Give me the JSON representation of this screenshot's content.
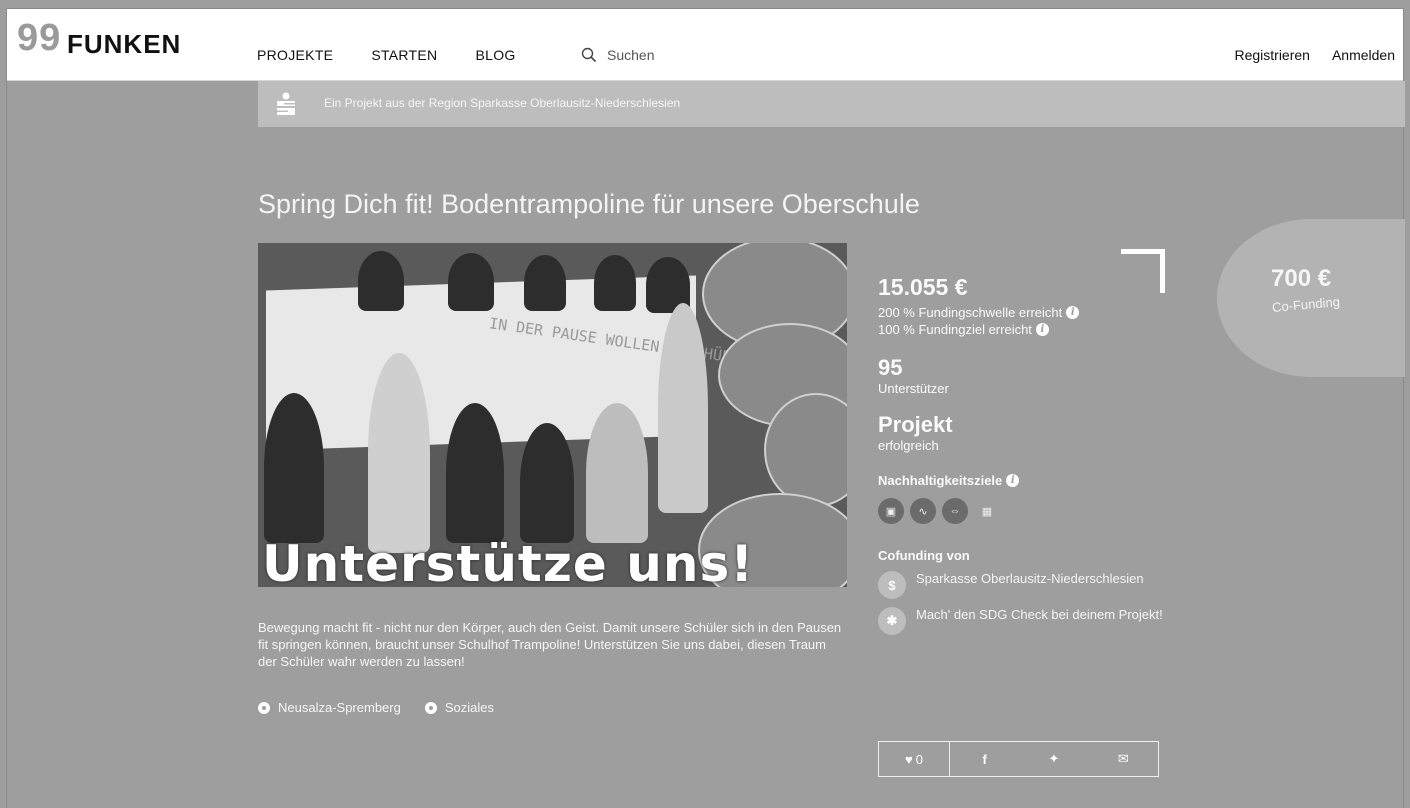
{
  "header": {
    "logo_num": "99",
    "logo_word": "FUNKEN",
    "nav": [
      "PROJEKTE",
      "STARTEN",
      "BLOG"
    ],
    "search_placeholder": "Suchen",
    "register": "Registrieren",
    "login": "Anmelden"
  },
  "region_banner": {
    "text": "Ein Projekt aus der Region Sparkasse Oberlausitz-Niederschlesien"
  },
  "project": {
    "title": "Spring Dich fit! Bodentrampoline für unsere Oberschule",
    "image_overlay_text": "Unterstütze uns!",
    "image_handwriting": "IN DER PAUSE WOLLEN WIR HÜPFEN",
    "description": "Bewegung macht fit - nicht nur den Körper, auch den Geist. Damit unsere Schüler sich in den Pausen fit springen können, braucht unser Schulhof Trampoline! Unterstützen Sie uns dabei, diesen Traum der Schüler wahr werden zu lassen!",
    "location": "Neusalza-Spremberg",
    "category": "Soziales"
  },
  "stats": {
    "amount": "15.055 €",
    "threshold": "200 % Fundingschwelle erreicht",
    "goal": "100 % Fundingziel erreicht",
    "supporters_count": "95",
    "supporters_label": "Unterstützer",
    "status_title": "Projekt",
    "status_value": "erfolgreich",
    "sdg_title": "Nachhaltigkeitsziele",
    "sdg_icons": [
      "book-icon",
      "heartbeat-icon",
      "equality-icon",
      "city-icon"
    ],
    "cofunding_title": "Cofunding von",
    "cofunders": [
      "Sparkasse Oberlausitz-Niederschlesien",
      "Mach' den SDG Check bei deinem Projekt!"
    ]
  },
  "cofunding_badge": {
    "amount": "700 €",
    "label": "Co-Funding"
  },
  "share": {
    "likes": "0"
  }
}
